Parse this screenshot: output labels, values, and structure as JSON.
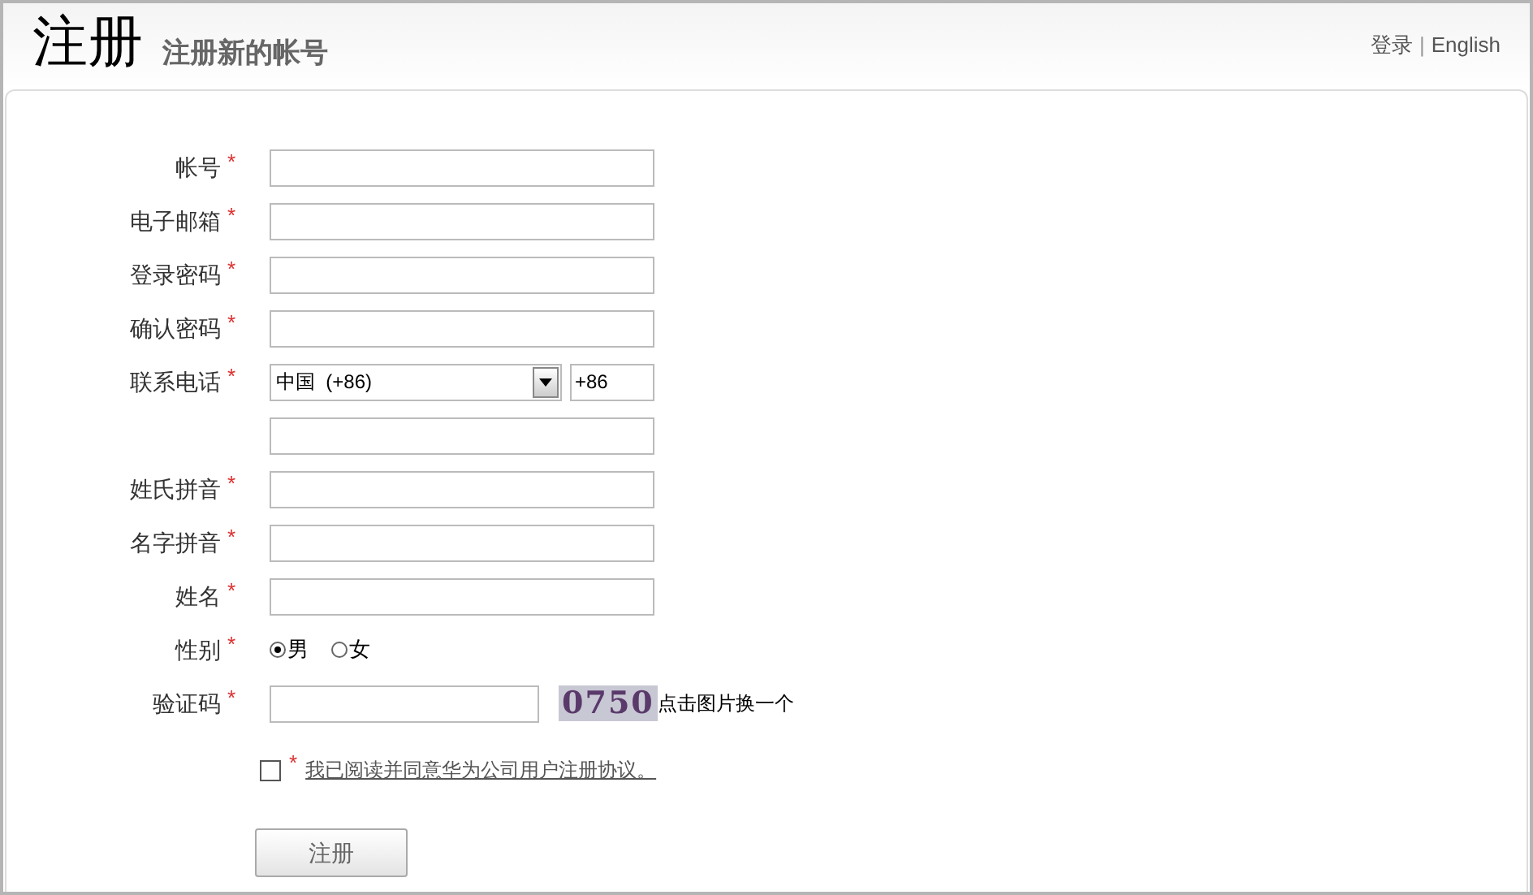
{
  "header": {
    "title": "注册",
    "subtitle": "注册新的帐号",
    "links": [
      "登录",
      "English"
    ],
    "separator": "|"
  },
  "fields": [
    {
      "kind": "text",
      "label": "帐号",
      "mark": "*"
    },
    {
      "kind": "text",
      "label": "电子邮箱",
      "mark": "*"
    },
    {
      "kind": "text",
      "label": "登录密码",
      "mark": "*"
    },
    {
      "kind": "text",
      "label": "确认密码",
      "mark": "*"
    },
    {
      "kind": "phone",
      "label": "联系电话",
      "mark": "*",
      "country": "中国  (+86)",
      "code": "+86"
    },
    {
      "kind": "text",
      "label": "姓氏拼音",
      "mark": "*"
    },
    {
      "kind": "text",
      "label": "名字拼音",
      "mark": "*"
    },
    {
      "kind": "text",
      "label": "姓名",
      "mark": "*"
    },
    {
      "kind": "radio",
      "label": "性别",
      "mark": "*",
      "options": [
        {
          "label": "男",
          "selected": true
        },
        {
          "label": "女",
          "selected": false
        }
      ]
    },
    {
      "kind": "captcha",
      "label": "验证码",
      "mark": "*",
      "captcha": "0750",
      "hint": "点击图片换一个"
    }
  ],
  "agreement": {
    "checked": false,
    "mark": "*",
    "link": "我已阅读并同意华为公司用户注册协议。"
  },
  "submit": "注册"
}
